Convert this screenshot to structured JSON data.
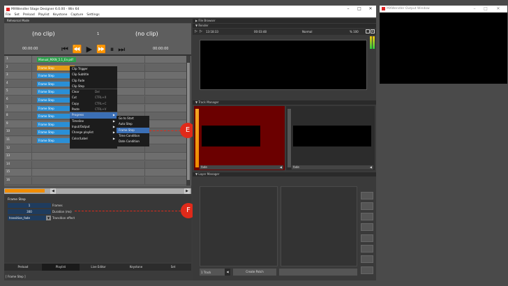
{
  "app": {
    "title": "MXWendler Stage Designer 6.0.00  -  Win 64",
    "menu": [
      "File",
      "Set",
      "Preload",
      "Playlist",
      "Keystone",
      "Capture",
      "Settings"
    ],
    "window_controls": [
      "–",
      "□",
      "✕"
    ]
  },
  "output_window": {
    "title": "MXWendler Output Window"
  },
  "rehearsal": {
    "mode_label": "Rehearsal Mode",
    "left_clip": "(no clip)",
    "counter": "1",
    "right_clip": "(no clip)",
    "left_time": "00:00:00",
    "right_time": "00:00:00"
  },
  "playlist": {
    "rows": [
      {
        "num": "1",
        "clip": "Manual_MXW_5.1_En.pdf",
        "color": "#2aa04a"
      },
      {
        "num": "2",
        "clip": "Frame Step",
        "color": "#e59b16"
      },
      {
        "num": "3",
        "clip": "Frame Step",
        "color": "#2a8fd6"
      },
      {
        "num": "4",
        "clip": "Frame Step",
        "color": "#2a8fd6"
      },
      {
        "num": "5",
        "clip": "Frame Step",
        "color": "#2a8fd6"
      },
      {
        "num": "6",
        "clip": "Frame Step",
        "color": "#2a8fd6"
      },
      {
        "num": "7",
        "clip": "Frame Step",
        "color": "#2a8fd6"
      },
      {
        "num": "8",
        "clip": "Frame Step",
        "color": "#2a8fd6"
      },
      {
        "num": "9",
        "clip": "Frame Step",
        "color": "#2a8fd6"
      },
      {
        "num": "10",
        "clip": "Frame Step",
        "color": "#2a8fd6"
      },
      {
        "num": "11",
        "clip": "Frame Step",
        "color": "#2a8fd6"
      },
      {
        "num": "12",
        "clip": "",
        "color": ""
      },
      {
        "num": "13",
        "clip": "",
        "color": ""
      },
      {
        "num": "14",
        "clip": "",
        "color": ""
      },
      {
        "num": "15",
        "clip": "",
        "color": ""
      },
      {
        "num": "16",
        "clip": "",
        "color": ""
      }
    ]
  },
  "context_menu": {
    "items": [
      {
        "label": "Clip Trigger",
        "shortcut": "",
        "arrow": false
      },
      {
        "label": "Clip Subtitle",
        "shortcut": "",
        "arrow": false
      },
      {
        "label": "Clip Fade",
        "shortcut": "",
        "arrow": false
      },
      {
        "label": "Clip Step",
        "shortcut": "",
        "arrow": false
      },
      {
        "label": "Clear",
        "shortcut": "Del",
        "arrow": false
      },
      {
        "label": "Cut",
        "shortcut": "CTRL+X",
        "arrow": false
      },
      {
        "label": "Copy",
        "shortcut": "CTRL+C",
        "arrow": false
      },
      {
        "label": "Paste",
        "shortcut": "CTRL+V",
        "arrow": false
      },
      {
        "label": "Progress",
        "shortcut": "",
        "arrow": true
      },
      {
        "label": "Timeline",
        "shortcut": "",
        "arrow": true
      },
      {
        "label": "Input/Output",
        "shortcut": "",
        "arrow": true
      },
      {
        "label": "Change playlist",
        "shortcut": "",
        "arrow": true
      },
      {
        "label": "Color/Label",
        "shortcut": "",
        "arrow": true
      }
    ],
    "submenu": [
      "Go to Start",
      "Auto Step",
      "Frame Step",
      "Time Condition",
      "Date Condition"
    ]
  },
  "clip_props": {
    "title": "Frame Step",
    "frames_value": "1",
    "frames_label": "Frames",
    "duration_value": "300",
    "duration_label": "Duration (ms)",
    "transition_value": "transition_fade",
    "transition_label": "Transition effect"
  },
  "bottom_tabs": [
    "Preload",
    "Playlist",
    "Live Editor",
    "Keystone",
    "Set"
  ],
  "status_bar": "[ Frame Step ]",
  "file_browser": {
    "title": "File Browser"
  },
  "render": {
    "title": "Render",
    "time1": "13:18:33",
    "time2": "00:03:48",
    "mode": "Normal",
    "zoom": "% 100"
  },
  "track_manager": {
    "title": "Track Manager",
    "track1_label": "fade",
    "track2_label": "fade"
  },
  "layer_manager": {
    "title": "Layer Manager",
    "track_label": "1 Track",
    "create_patch": "Create Patch"
  },
  "markers": {
    "e": "E",
    "f": "F"
  }
}
